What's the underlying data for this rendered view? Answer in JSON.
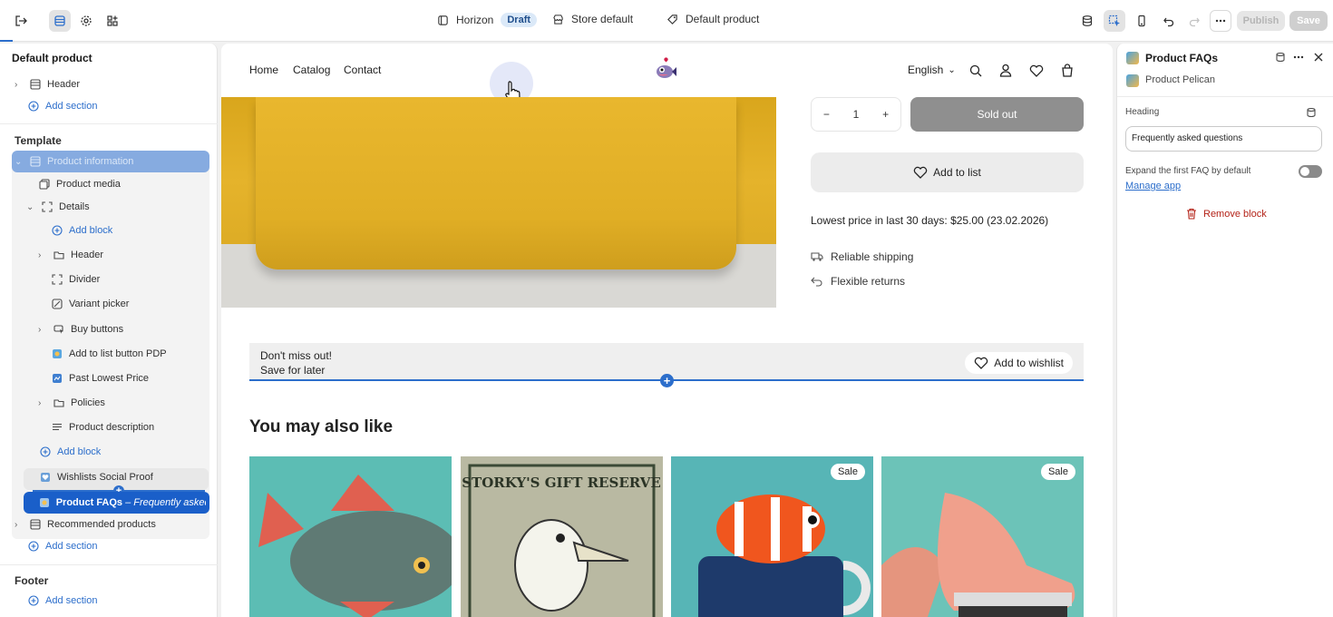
{
  "topbar": {
    "theme_name": "Horizon",
    "theme_status": "Draft",
    "store": "Store default",
    "template": "Default product",
    "publish_label": "Publish",
    "save_label": "Save"
  },
  "left_panel": {
    "title": "Default product",
    "header_section": "Header",
    "add_section": "Add section",
    "template_label": "Template",
    "template_items": {
      "product_information": "Product information",
      "product_media": "Product media",
      "details": "Details",
      "add_block": "Add block",
      "header": "Header",
      "divider": "Divider",
      "variant_picker": "Variant picker",
      "buy_buttons": "Buy buttons",
      "add_to_list": "Add to list button PDP",
      "past_lowest": "Past Lowest Price",
      "policies": "Policies",
      "product_description": "Product description",
      "add_block_outer": "Add block",
      "wishlists": "Wishlists Social Proof",
      "faq_name": "Product FAQs",
      "faq_detail": " – Frequently asked ...",
      "recommended": "Recommended products",
      "add_section": "Add section"
    },
    "footer_label": "Footer",
    "footer_add": "Add section"
  },
  "preview": {
    "nav": [
      "Home",
      "Catalog",
      "Contact"
    ],
    "language": "English",
    "qty": "1",
    "sold_out": "Sold out",
    "add_to_list": "Add to list",
    "lowest_price": "Lowest price in last 30 days: $25.00 (23.02.2026)",
    "features": [
      "Reliable shipping",
      "Flexible returns"
    ],
    "wishlist_line1": "Don't miss out!",
    "wishlist_line2": "Save for later",
    "wishlist_button": "Add to wishlist",
    "ymal": "You may also like",
    "sale_badge": "Sale",
    "gift_text": "STORKY'S GIFT RESERVE"
  },
  "right_panel": {
    "title": "Product FAQs",
    "app_name": "Product Pelican",
    "heading_label": "Heading",
    "heading_value": "Frequently asked questions",
    "expand_label": "Expand the first FAQ by default",
    "manage_app": "Manage app",
    "remove_block": "Remove block"
  },
  "colors": {
    "accent": "#2c6ecb",
    "selected": "#1a5fc9",
    "danger": "#b42318"
  }
}
